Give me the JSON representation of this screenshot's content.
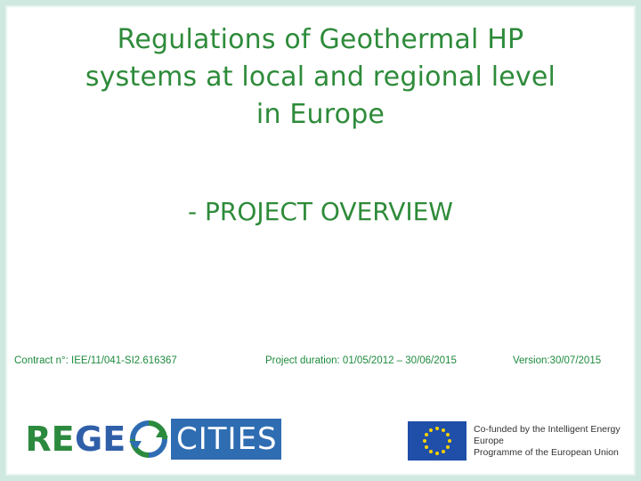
{
  "slide": {
    "title_lines": [
      "Regulations of Geothermal HP",
      "systems at local and regional level",
      "in Europe"
    ],
    "subtitle": "- PROJECT OVERVIEW",
    "contract": "Contract n°: IEE/11/041-SI2.616367",
    "duration": "Project duration: 01/05/2012 – 30/06/2015",
    "version": "Version:30/07/2015"
  },
  "logo": {
    "part1": "RE",
    "part2": "GE",
    "part3": "CITIES",
    "colors": {
      "green": "#2b8a3e",
      "blue": "#2f6db2",
      "darkblue": "#2f5fa8"
    }
  },
  "eu": {
    "line1": "Co-funded by the Intelligent Energy Europe",
    "line2": "Programme of the European Union",
    "flag_color": "#1f4fa8",
    "star_color": "#ffd200"
  },
  "theme": {
    "title_color": "#2e8b3a",
    "frame_color": "#cfe9e0"
  }
}
